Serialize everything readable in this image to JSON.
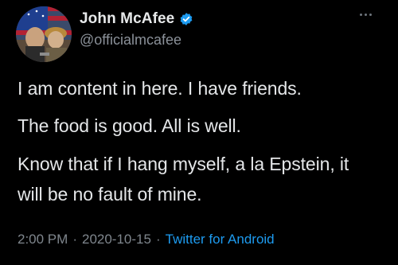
{
  "author": {
    "display_name": "John McAfee",
    "handle": "@officialmcafee",
    "verified": true,
    "avatar_icon": "profile-photo"
  },
  "tweet": {
    "lines": [
      "I am content in here. I have friends.",
      "The food is good. All is well.",
      "Know that if I hang myself, a la Epstein, it",
      "will be no fault of mine."
    ]
  },
  "meta": {
    "time": "2:00 PM",
    "separator": "·",
    "date": "2020-10-15",
    "source": "Twitter for Android"
  },
  "icons": {
    "more": "more-horizontal-icon",
    "verified": "verified-badge-icon"
  },
  "colors": {
    "background": "#000000",
    "text": "#e4e6e8",
    "secondary": "#7f868d",
    "link": "#1d9bf0",
    "verified": "#1d9bf0"
  }
}
